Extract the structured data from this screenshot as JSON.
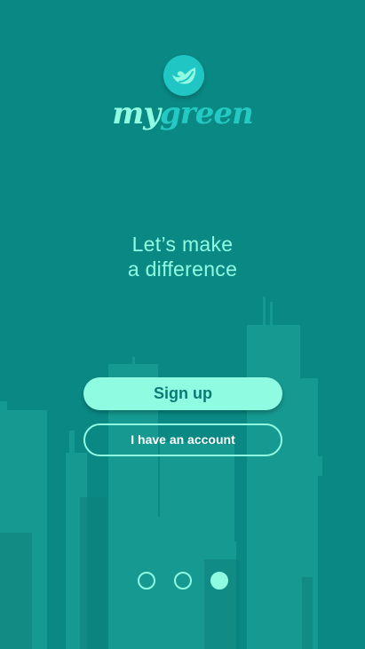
{
  "app": {
    "brand_prefix": "my",
    "brand_suffix": "green"
  },
  "welcome": {
    "tagline_line1": "Let’s make",
    "tagline_line2": "a difference"
  },
  "actions": {
    "signup_label": "Sign up",
    "account_label": "I have an account"
  },
  "carousel": {
    "page_count": 3,
    "active_page": 3
  },
  "colors": {
    "background": "#0a8984",
    "accent": "#8ffbe1",
    "brand_teal": "#24c9c3"
  }
}
